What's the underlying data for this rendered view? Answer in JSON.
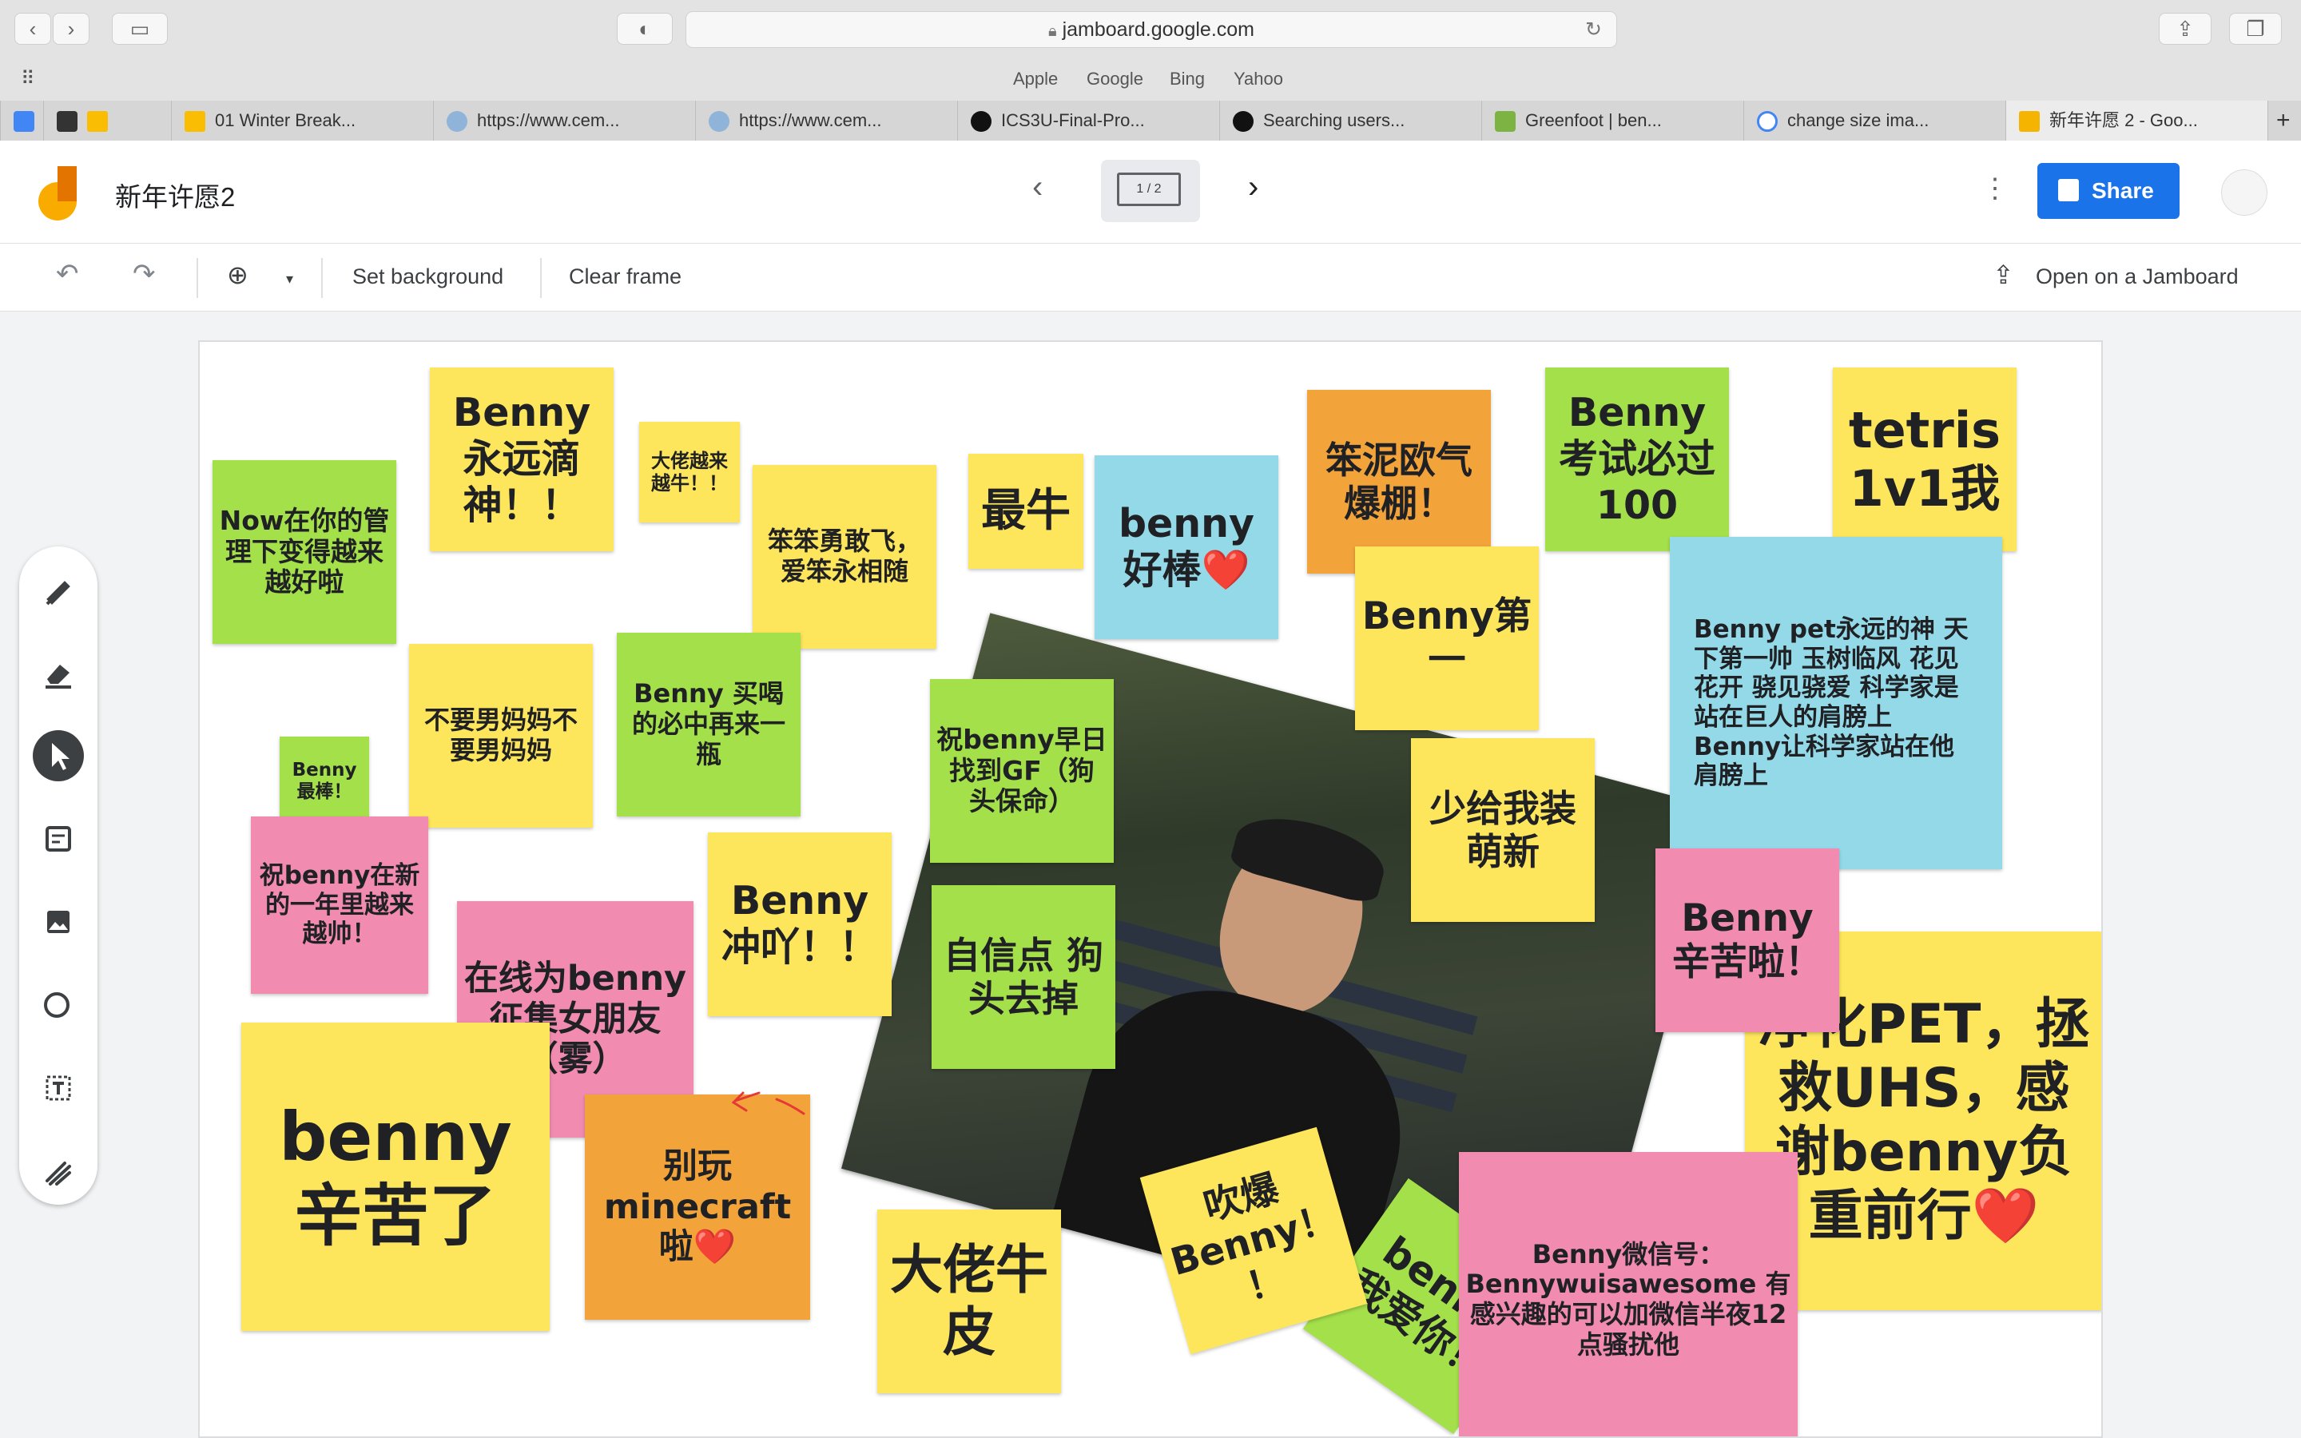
{
  "browser": {
    "url": "jamboard.google.com",
    "favorites": [
      "Apple",
      "Google",
      "Bing",
      "Yahoo"
    ],
    "tabs": [
      "01 Winter Break...",
      "https://www.cem...",
      "https://www.cem...",
      "ICS3U-Final-Pro...",
      "Searching users...",
      "Greenfoot | ben...",
      "change size ima...",
      "新年许愿 2 - Goo..."
    ],
    "new_tab": "+"
  },
  "app": {
    "title": "新年许愿2",
    "frame_counter": "1 / 2",
    "share_label": "Share",
    "set_background": "Set background",
    "clear_frame": "Clear frame",
    "open_on_jamboard": "Open on a Jamboard"
  },
  "notes": [
    {
      "text": "Now在你的管理下变得越来越好啦"
    },
    {
      "text": "Benny 永远滴神！！"
    },
    {
      "text": "大佬越来越牛！！"
    },
    {
      "text": "笨笨勇敢飞，爱笨永相随"
    },
    {
      "text": "最牛"
    },
    {
      "text": "benny好棒",
      "emoji": "❤️"
    },
    {
      "text": "笨泥欧气爆棚！"
    },
    {
      "text": "Benny 考试必过100"
    },
    {
      "text": "tetris 1v1我"
    },
    {
      "text": "Benny第一"
    },
    {
      "text": "Benny pet永远的神 天下第一帅 玉树临风 花见花开 骁见骁爱 科学家是站在巨人的肩膀上 Benny让科学家站在他肩膀上"
    },
    {
      "text": "Benny最棒！"
    },
    {
      "text": "不要男妈妈不要男妈妈"
    },
    {
      "text": "Benny 买喝的必中再来一瓶"
    },
    {
      "text": "祝benny早日找到GF（狗头保命）"
    },
    {
      "text": "少给我装萌新"
    },
    {
      "text": "祝benny在新的一年里越来越帅！"
    },
    {
      "text": "Benny 冲吖！！"
    },
    {
      "text": "自信点 狗头去掉"
    },
    {
      "text": "Benny 辛苦啦！"
    },
    {
      "text": "在线为benny征集女朋友（雾）"
    },
    {
      "text": "benny辛苦了"
    },
    {
      "text": "别玩minecraft啦",
      "emoji": "❤️"
    },
    {
      "text": "大佬牛皮"
    },
    {
      "text": "吹爆Benny！！"
    },
    {
      "text": "benny我爱你！"
    },
    {
      "text": "Benny微信号：Bennywuisawesome 有感兴趣的可以加微信半夜12点骚扰他"
    },
    {
      "text": "净化PET，拯救UHS，感谢benny负重前行",
      "emoji": "❤️"
    }
  ],
  "icons": [
    "back-icon",
    "forward-icon",
    "sidebar-icon",
    "shield-icon",
    "reload-icon",
    "share-icon",
    "tabs-icon",
    "grid-icon",
    "undo-icon",
    "redo-icon",
    "zoom-icon",
    "pen-icon",
    "eraser-icon",
    "select-icon",
    "sticky-note-icon",
    "image-icon",
    "circle-icon",
    "textbox-icon",
    "laser-icon",
    "more-icon",
    "prev-frame-icon",
    "next-frame-icon",
    "open-jamboard-icon"
  ]
}
